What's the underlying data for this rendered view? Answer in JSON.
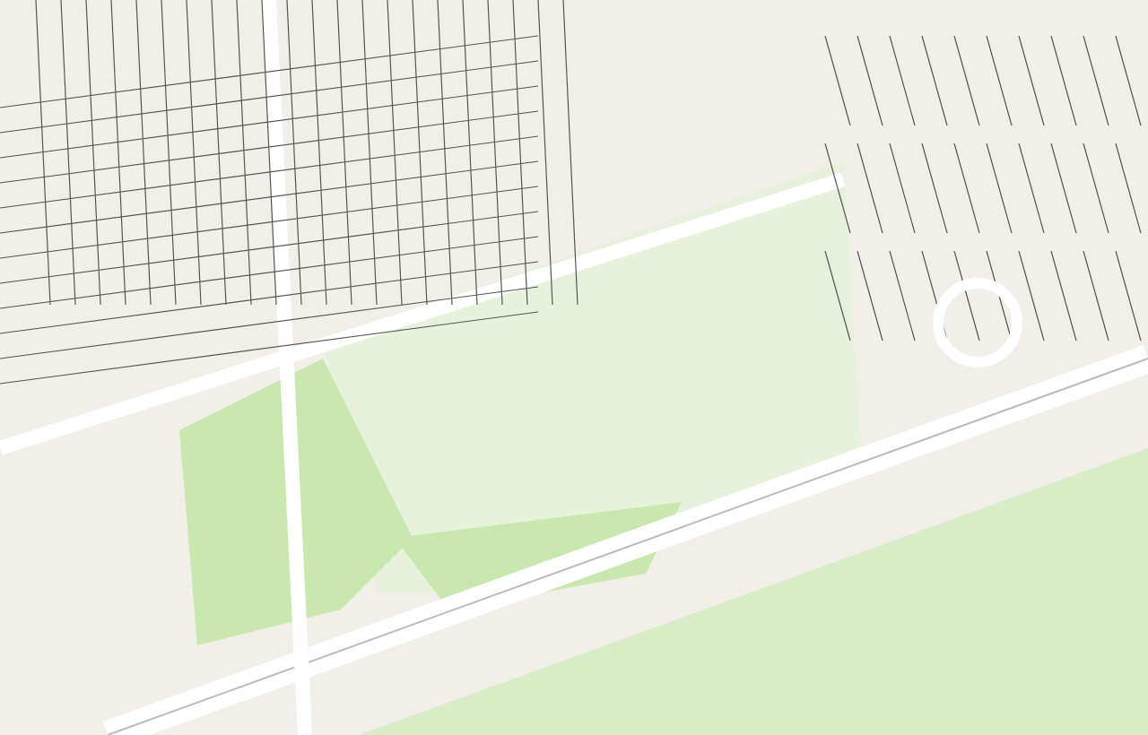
{
  "map": {
    "kind": "cadastral-map-tile"
  }
}
